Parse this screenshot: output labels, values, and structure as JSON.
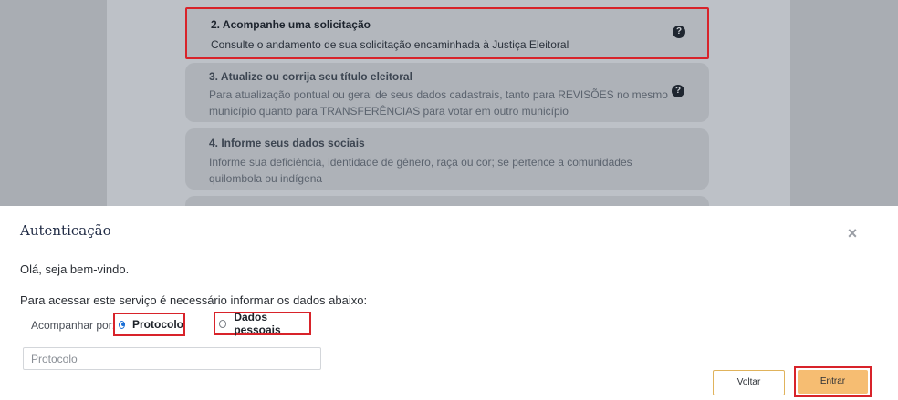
{
  "background": {
    "cards": [
      {
        "title": "2. Acompanhe uma solicitação",
        "desc": "Consulte o andamento de sua solicitação encaminhada à Justiça Eleitoral",
        "help_icon": "question-circle-icon"
      },
      {
        "title": "3. Atualize ou corrija seu título eleitoral",
        "desc": "Para atualização pontual ou geral de seus dados cadastrais, tanto para REVISÕES no mesmo município quanto para TRANSFERÊNCIAS para votar em outro município",
        "help_icon": "question-circle-icon"
      },
      {
        "title": "4. Informe seus dados sociais",
        "desc": "Informe sua deficiência, identidade de gênero, raça ou cor; se pertence a comunidades quilombola ou indígena"
      }
    ]
  },
  "modal": {
    "title": "Autenticação",
    "close_glyph": "×",
    "greeting": "Olá, seja bem-vindo.",
    "instructions": "Para acessar este serviço é necessário informar os dados abaixo:",
    "track_label": "Acompanhar por:",
    "options": [
      {
        "label": "Protocolo",
        "checked": true
      },
      {
        "label": "Dados pessoais",
        "checked": false
      }
    ],
    "input": {
      "placeholder": "Protocolo",
      "value": ""
    },
    "buttons": {
      "back": "Voltar",
      "enter": "Entrar"
    }
  },
  "colors": {
    "highlight": "#d8232a",
    "enter_button": "#f6bd72",
    "radio_selected": "#1a6fd6",
    "divider": "#ecd996"
  }
}
